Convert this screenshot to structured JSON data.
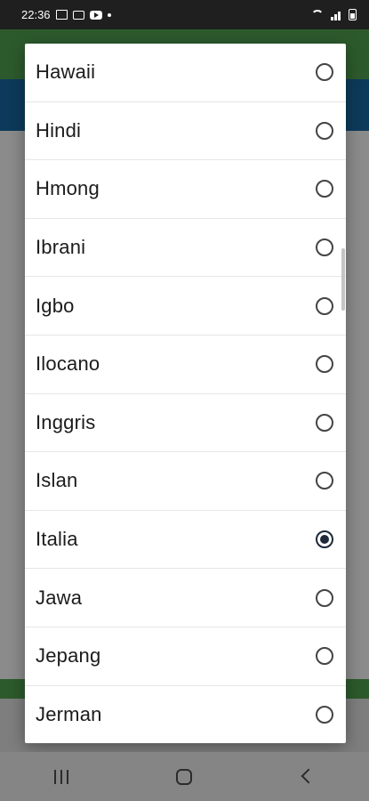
{
  "status_bar": {
    "time": "22:36",
    "icons": [
      "image-icon",
      "message-icon",
      "youtube-icon",
      "dot-icon",
      "wifi-icon",
      "signal-icon",
      "battery-icon"
    ]
  },
  "language_dialog": {
    "options": [
      {
        "label": "Hawaii",
        "selected": false
      },
      {
        "label": "Hindi",
        "selected": false
      },
      {
        "label": "Hmong",
        "selected": false
      },
      {
        "label": "Ibrani",
        "selected": false
      },
      {
        "label": "Igbo",
        "selected": false
      },
      {
        "label": "Ilocano",
        "selected": false
      },
      {
        "label": "Inggris",
        "selected": false
      },
      {
        "label": "Islan",
        "selected": false
      },
      {
        "label": "Italia",
        "selected": true
      },
      {
        "label": "Jawa",
        "selected": false
      },
      {
        "label": "Jepang",
        "selected": false
      },
      {
        "label": "Jerman",
        "selected": false
      }
    ]
  },
  "navigation_bar": {
    "buttons": [
      "recents-icon",
      "home-icon",
      "back-icon"
    ]
  },
  "colors": {
    "selected_radio": "#1c2a3a",
    "dialog_background": "#ffffff",
    "scrim": "#8b8b8b"
  }
}
